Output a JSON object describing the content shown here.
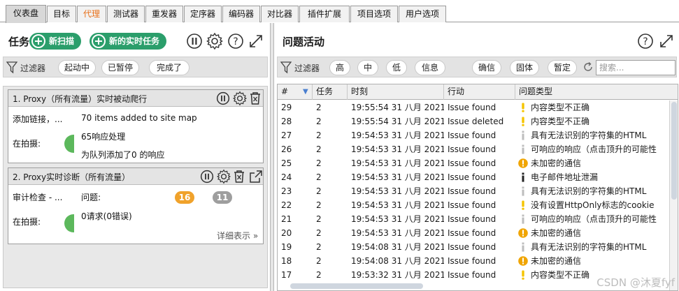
{
  "tabs": [
    {
      "label": "仪表盘",
      "active": true
    },
    {
      "label": "目标"
    },
    {
      "label": "代理",
      "highlight": true
    },
    {
      "label": "测试器"
    },
    {
      "label": "重发器"
    },
    {
      "label": "定序器"
    },
    {
      "label": "编码器"
    },
    {
      "label": "对比器"
    },
    {
      "label": "插件扩展"
    },
    {
      "label": "项目选项"
    },
    {
      "label": "用户选项"
    }
  ],
  "tasks_panel": {
    "title": "任务",
    "new_scan": "新扫描",
    "new_live_task": "新的实时任务",
    "filter_label": "过滤器",
    "filters": [
      "起动中",
      "已暂停",
      "完成了"
    ]
  },
  "task1": {
    "title": "1. Proxy（所有流量）实时被动爬行",
    "row1_label": "添加链接，...",
    "row1_value": "70 items added to site map",
    "row2_label": "在拍摄:",
    "row2_value_a": "65响应处理",
    "row2_value_b": "为队列添加了0 的响应"
  },
  "task2": {
    "title": "2. Proxy实时诊断（所有流量）",
    "row1_label": "审计检查 - ...",
    "issues_label": "问题:",
    "badge_high": "16",
    "badge_info": "11",
    "row2_label": "在拍摄:",
    "row2_value": "0请求(0错误)",
    "details_link": "详细表示"
  },
  "issues_panel": {
    "title": "问题活动",
    "filter_label": "过滤器",
    "severity_filters": [
      "高",
      "中",
      "低",
      "信息"
    ],
    "confidence_filters": [
      "确信",
      "固体",
      "暂定"
    ],
    "search_placeholder": "搜索..."
  },
  "table": {
    "columns": [
      "#",
      "任务",
      "时刻",
      "行动",
      "问题类型"
    ],
    "rows": [
      {
        "id": "29",
        "task": "2",
        "time": "19:55:54 31 八月 2021",
        "action": "Issue found",
        "sev": "medium",
        "type": "内容类型不正确"
      },
      {
        "id": "28",
        "task": "2",
        "time": "19:55:54 31 八月 2021",
        "action": "Issue deleted",
        "sev": "medium",
        "type": "内容类型不正确"
      },
      {
        "id": "27",
        "task": "2",
        "time": "19:54:53 31 八月 2021",
        "action": "Issue found",
        "sev": "info-faint",
        "type": "具有无法识别的字符集的HTML"
      },
      {
        "id": "26",
        "task": "2",
        "time": "19:54:53 31 八月 2021",
        "action": "Issue found",
        "sev": "info-faint",
        "type": "可响应的响应（点击顶升的可能性"
      },
      {
        "id": "25",
        "task": "2",
        "time": "19:54:53 31 八月 2021",
        "action": "Issue found",
        "sev": "high",
        "type": "未加密的通信"
      },
      {
        "id": "24",
        "task": "2",
        "time": "19:54:53 31 八月 2021",
        "action": "Issue found",
        "sev": "info",
        "type": "电子邮件地址泄漏"
      },
      {
        "id": "23",
        "task": "2",
        "time": "19:54:53 31 八月 2021",
        "action": "Issue found",
        "sev": "info-faint",
        "type": "具有无法识别的字符集的HTML"
      },
      {
        "id": "22",
        "task": "2",
        "time": "19:54:53 31 八月 2021",
        "action": "Issue found",
        "sev": "medium",
        "type": "没有设置HttpOnly标志的cookie"
      },
      {
        "id": "21",
        "task": "2",
        "time": "19:54:53 31 八月 2021",
        "action": "Issue found",
        "sev": "info-faint",
        "type": "可响应的响应（点击顶升的可能性"
      },
      {
        "id": "20",
        "task": "2",
        "time": "19:54:53 31 八月 2021",
        "action": "Issue found",
        "sev": "high",
        "type": "未加密的通信"
      },
      {
        "id": "19",
        "task": "2",
        "time": "19:54:08 31 八月 2021",
        "action": "Issue found",
        "sev": "info-faint",
        "type": "具有无法识别的字符集的HTML"
      },
      {
        "id": "18",
        "task": "2",
        "time": "19:54:08 31 八月 2021",
        "action": "Issue found",
        "sev": "high",
        "type": "未加密的通信"
      },
      {
        "id": "17",
        "task": "2",
        "time": "19:53:32 31 八月 2021",
        "action": "Issue found",
        "sev": "medium",
        "type": "内容类型不正确"
      }
    ]
  },
  "watermark": "CSDN @沐夏fyf",
  "colors": {
    "green_button": "#2b9e6b",
    "orange_tab": "#e8701a",
    "badge_high": "#f0a22b",
    "badge_info": "#9e9e9e",
    "severity_medium": "#f5c400",
    "severity_high": "#f0a500",
    "severity_info": "#222222"
  }
}
